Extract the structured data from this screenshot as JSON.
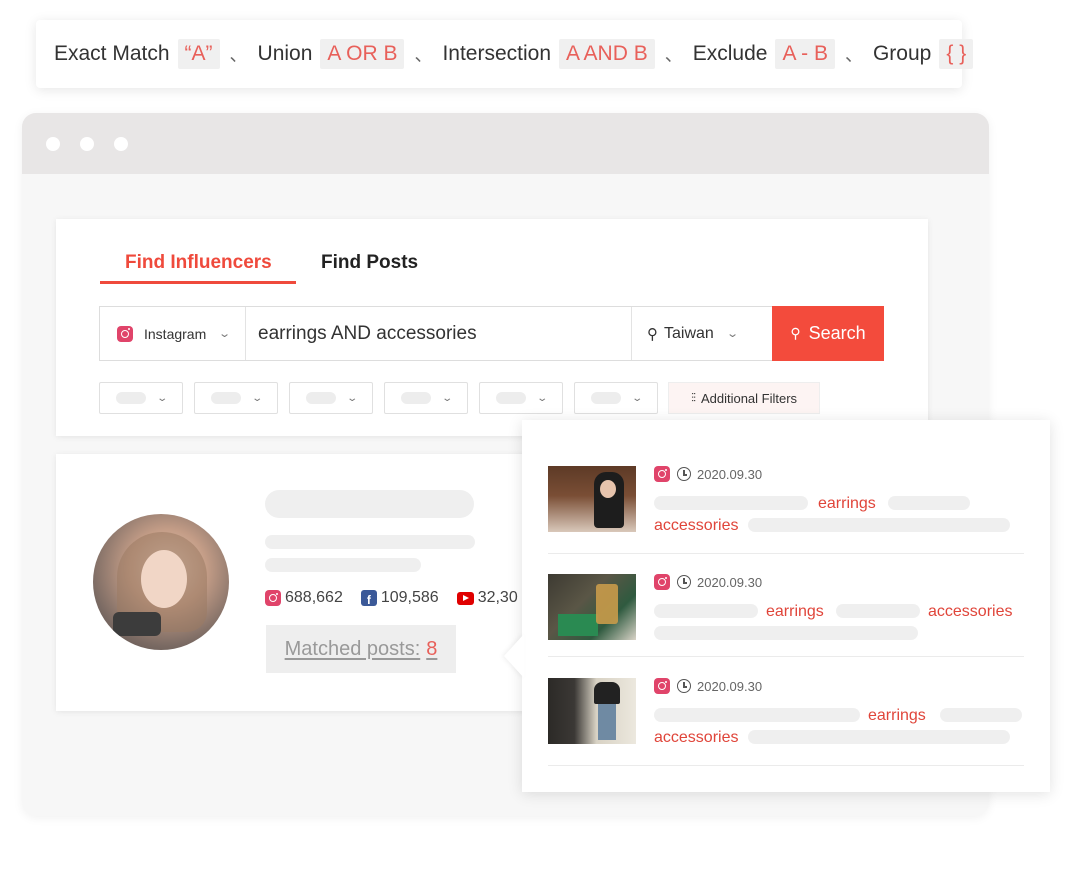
{
  "operators": [
    {
      "label": "Exact Match",
      "syntax": "“A”"
    },
    {
      "label": "Union",
      "syntax": "A OR B"
    },
    {
      "label": "Intersection",
      "syntax": "A AND B"
    },
    {
      "label": "Exclude",
      "syntax": "A - B"
    },
    {
      "label": "Group",
      "syntax": "{ }"
    }
  ],
  "separator": "、",
  "tabs": {
    "find_influencers": "Find Influencers",
    "find_posts": "Find Posts"
  },
  "search": {
    "platform": "Instagram",
    "query": "earrings AND accessories",
    "location": "Taiwan",
    "button_label": "Search"
  },
  "filters": {
    "additional_label": "Additional Filters"
  },
  "influencer": {
    "instagram_followers": "688,662",
    "facebook_followers": "109,586",
    "youtube_subscribers": "32,30",
    "matched_posts_label": "Matched posts:",
    "matched_posts_count": "8"
  },
  "posts": [
    {
      "date": "2020.09.30",
      "keywords": [
        "earrings",
        "accessories"
      ]
    },
    {
      "date": "2020.09.30",
      "keywords": [
        "earrings",
        "accessories"
      ]
    },
    {
      "date": "2020.09.30",
      "keywords": [
        "earrings",
        "accessories"
      ]
    }
  ],
  "colors": {
    "accent": "#ef4a3c",
    "keyword": "#e0453a",
    "instagram": "#e0446a",
    "facebook": "#3b5998",
    "youtube": "#e00000"
  },
  "icons": {
    "platform": "instagram-icon",
    "location": "map-pin-icon",
    "search": "search-icon",
    "filters": "sliders-icon",
    "date": "clock-icon"
  }
}
